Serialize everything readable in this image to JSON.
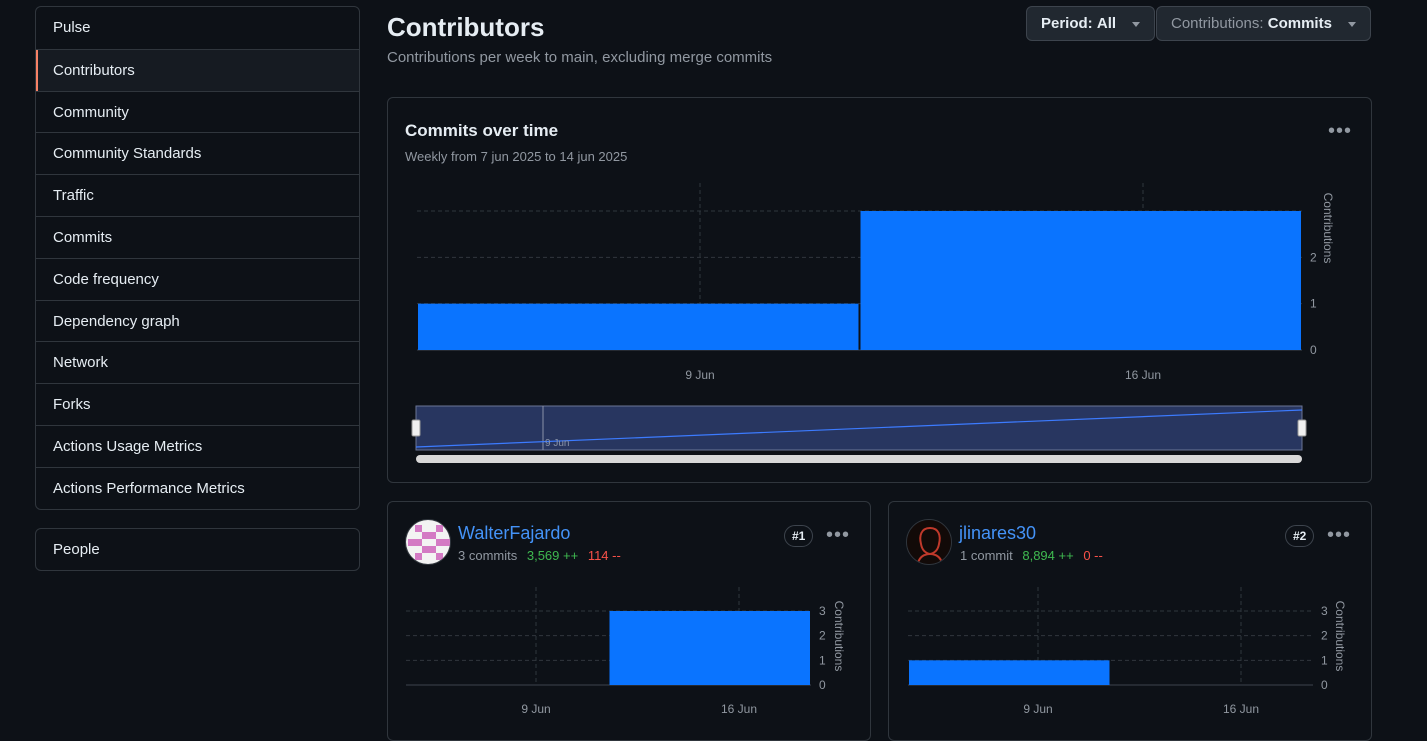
{
  "sidebar": {
    "items": [
      {
        "label": "Pulse"
      },
      {
        "label": "Contributors"
      },
      {
        "label": "Community"
      },
      {
        "label": "Community Standards"
      },
      {
        "label": "Traffic"
      },
      {
        "label": "Commits"
      },
      {
        "label": "Code frequency"
      },
      {
        "label": "Dependency graph"
      },
      {
        "label": "Network"
      },
      {
        "label": "Forks"
      },
      {
        "label": "Actions Usage Metrics"
      },
      {
        "label": "Actions Performance Metrics"
      }
    ],
    "people": "People",
    "active": "Contributors"
  },
  "header": {
    "title": "Contributors",
    "subtitle": "Contributions per week to main, excluding merge commits",
    "period_label": "Period:",
    "period_value": "All",
    "contrib_label": "Contributions:",
    "contrib_value": "Commits"
  },
  "main_chart": {
    "title": "Commits over time",
    "subtitle": "Weekly from 7 jun 2025 to 14 jun 2025",
    "axis_title": "Contributions",
    "navigator_label": "9 Jun"
  },
  "contributors": [
    {
      "name": "WalterFajardo",
      "commits": "3 commits",
      "additions": "3,569 ++",
      "deletions": "114 --",
      "rank": "#1"
    },
    {
      "name": "jlinares30",
      "commits": "1 commit",
      "additions": "8,894 ++",
      "deletions": "0 --",
      "rank": "#2"
    }
  ],
  "colors": {
    "bar": "#0a74ff",
    "accent": "#f78166",
    "link": "#4493f8",
    "add": "#3fb950",
    "del": "#f85149"
  },
  "chart_data": [
    {
      "type": "bar",
      "title": "Commits over time",
      "x": [
        "7 Jun 2025",
        "14 Jun 2025"
      ],
      "values": [
        1,
        3
      ],
      "xticks": [
        "9 Jun",
        "16 Jun"
      ],
      "yticks": [
        0,
        1,
        2
      ],
      "ylabel": "Contributions",
      "ylim": [
        0,
        3
      ]
    },
    {
      "type": "bar",
      "title": "WalterFajardo",
      "x": [
        "7 Jun 2025",
        "14 Jun 2025"
      ],
      "values": [
        0,
        3
      ],
      "xticks": [
        "9 Jun",
        "16 Jun"
      ],
      "yticks": [
        0,
        1,
        2,
        3
      ],
      "ylabel": "Contributions",
      "ylim": [
        0,
        3
      ]
    },
    {
      "type": "bar",
      "title": "jlinares30",
      "x": [
        "7 Jun 2025",
        "14 Jun 2025"
      ],
      "values": [
        1,
        0
      ],
      "xticks": [
        "9 Jun",
        "16 Jun"
      ],
      "yticks": [
        0,
        1,
        2,
        3
      ],
      "ylabel": "Contributions",
      "ylim": [
        0,
        3
      ]
    }
  ]
}
